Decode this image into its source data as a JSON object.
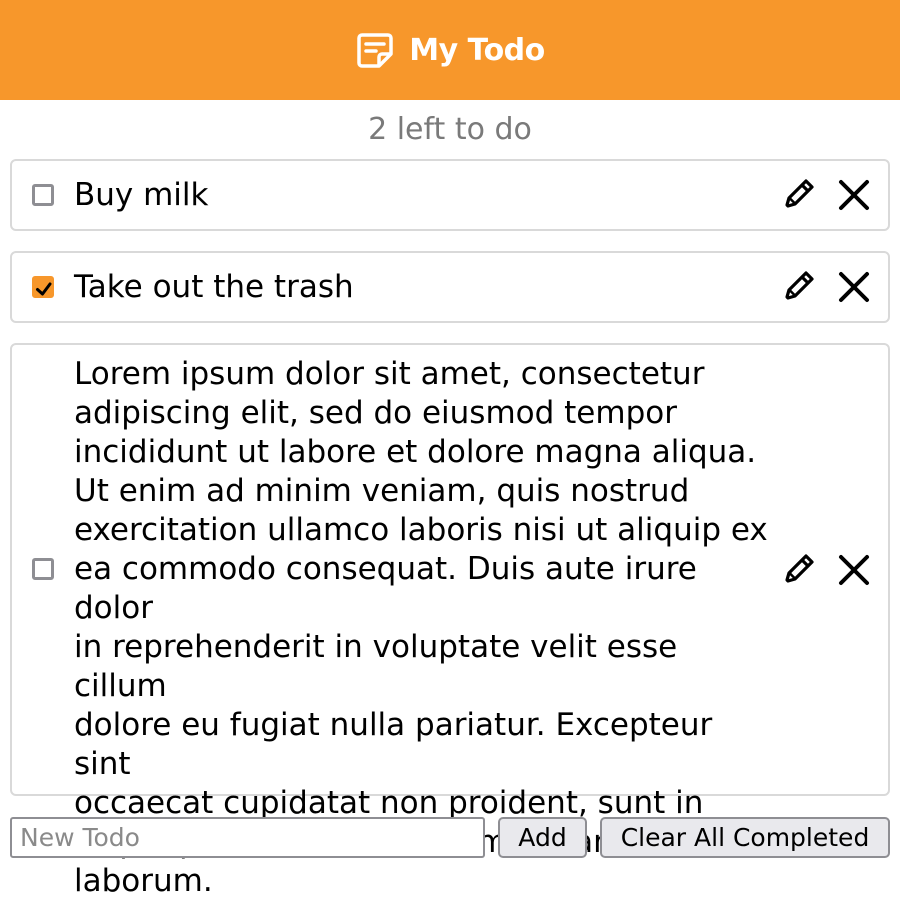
{
  "header": {
    "title": "My Todo",
    "logo_icon": "sticky-note-icon",
    "background_color": "#f7972b"
  },
  "summary": {
    "left_text": "2 left to do"
  },
  "todos": [
    {
      "text": "Buy milk",
      "completed": false,
      "edit_icon": "pencil-icon",
      "delete_icon": "close-icon"
    },
    {
      "text": "Take out the trash",
      "completed": true,
      "edit_icon": "pencil-icon",
      "delete_icon": "close-icon"
    },
    {
      "text": "Lorem ipsum dolor sit amet, consectetur\nadipiscing elit, sed do eiusmod tempor\nincididunt ut labore et dolore magna aliqua.\nUt enim ad minim veniam, quis nostrud\nexercitation ullamco laboris nisi ut aliquip ex\nea commodo consequat. Duis aute irure dolor\nin reprehenderit in voluptate velit esse cillum\ndolore eu fugiat nulla pariatur. Excepteur sint\noccaecat cupidatat non proident, sunt in\nculpa qui officia deserunt mollit anim id est\nlaborum.",
      "completed": false,
      "edit_icon": "pencil-icon",
      "delete_icon": "close-icon"
    }
  ],
  "new_todo": {
    "placeholder": "New Todo",
    "value": ""
  },
  "actions": {
    "add_label": "Add",
    "clear_label": "Clear All Completed"
  },
  "colors": {
    "accent": "#f7972b",
    "muted_text": "#7a7a7a",
    "border": "#d9d9d9"
  }
}
